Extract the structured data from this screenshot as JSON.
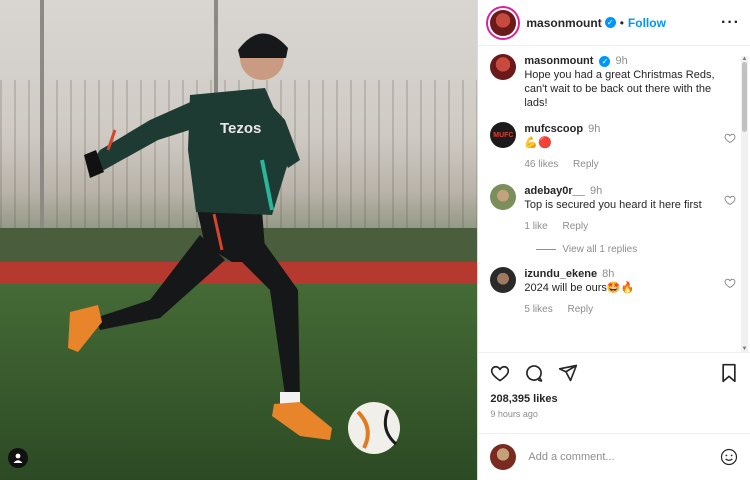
{
  "header": {
    "username": "masonmount",
    "follow_label": "Follow",
    "dot": "•",
    "more": "···"
  },
  "caption": {
    "username": "masonmount",
    "time": "9h",
    "text": "Hope you had a great Christmas Reds, can't wait to be back out there with the lads!"
  },
  "comments": [
    {
      "username": "mufcscoop",
      "time": "9h",
      "text": "💪🔴",
      "likes": "46 likes",
      "reply": "Reply",
      "avatar_color": "#1b1b1b"
    },
    {
      "username": "adebay0r__",
      "time": "9h",
      "text": "Top is secured you heard it here first",
      "likes": "1 like",
      "reply": "Reply",
      "avatar_color": "#7a8f5a"
    },
    {
      "username": "izundu_ekene",
      "time": "8h",
      "text": "2024 will be ours🤩🔥",
      "likes": "5 likes",
      "reply": "Reply",
      "avatar_color": "#2a2a2a"
    }
  ],
  "view_replies": "View all 1 replies",
  "stats": {
    "likes": "208,395 likes",
    "posted": "9 hours ago"
  },
  "add_comment": {
    "placeholder": "Add a comment..."
  },
  "photo": {
    "sponsor": "Tezos"
  }
}
